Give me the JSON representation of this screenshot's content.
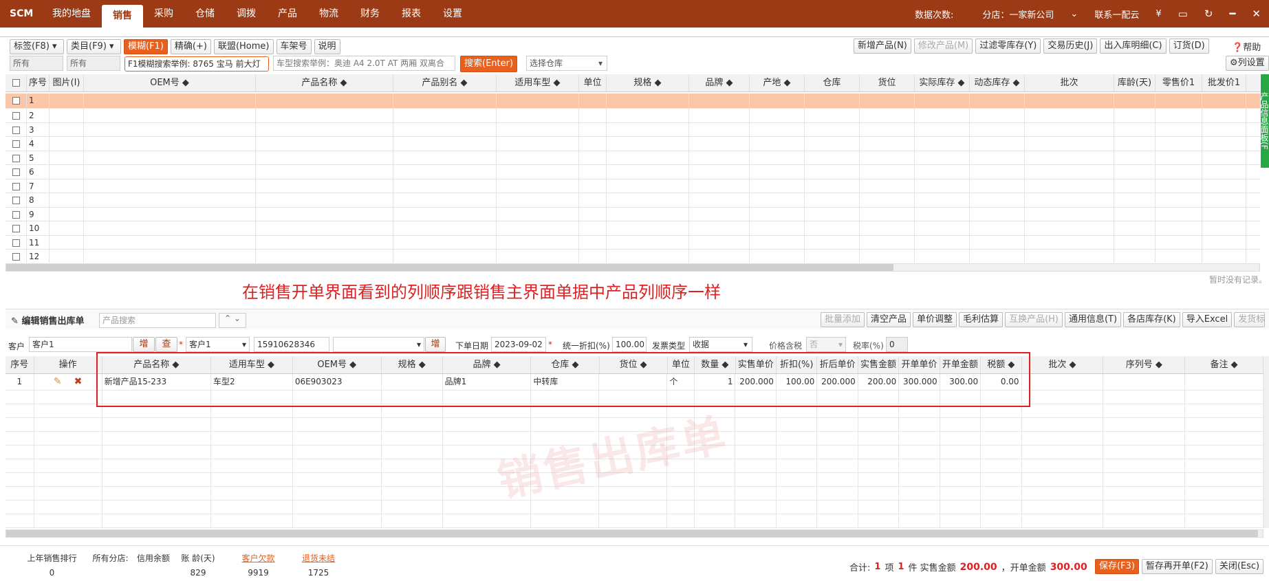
{
  "topbar": {
    "logo": "SCM",
    "nav": [
      "我的地盘",
      "销售",
      "采购",
      "仓储",
      "调拨",
      "产品",
      "物流",
      "财务",
      "报表",
      "设置"
    ],
    "active_index": 1,
    "data_count": "数据次数:",
    "branch": "分店：一家新公司",
    "account": "联系一配云",
    "currency": "¥",
    "accent": "#9b3a14"
  },
  "toolbar": {
    "tag_select": "标签(F8)",
    "category_select": "类目(F9)",
    "fuzzy_btn": "模糊(F1)",
    "exact_btn": "精确(+)",
    "alliance_btn": "联盟(Home)",
    "vin_btn": "车架号",
    "help_text_btn": "说明",
    "tag_value": "所有",
    "category_value": "所有",
    "search_hint": "F1模糊搜索举例: 8765 宝马 前大灯",
    "car_hint": "车型搜索举例：奥迪 A4 2.0T AT 两厢 双离合",
    "search_btn": "搜索(Enter)",
    "warehouse_select": "选择仓库",
    "new_product": "新增产品(N)",
    "edit_product": "修改产品(M)",
    "filter_zero": "过滤零库存(Y)",
    "trade_history": "交易历史(J)",
    "in_out_detail": "出入库明细(C)",
    "order": "订货(D)",
    "help": "帮助",
    "column_settings": "列设置"
  },
  "top_table": {
    "headers": [
      "序号",
      "图片(I)",
      "OEM号 ◆",
      "产品名称 ◆",
      "产品别名 ◆",
      "适用车型 ◆",
      "单位",
      "规格 ◆",
      "品牌 ◆",
      "产地 ◆",
      "仓库",
      "货位",
      "实际库存 ◆",
      "动态库存 ◆",
      "批次",
      "库龄(天)",
      "零售价1",
      "批发价1"
    ],
    "rows": [
      "1",
      "2",
      "3",
      "4",
      "5",
      "6",
      "7",
      "8",
      "9",
      "10",
      "11",
      "12"
    ],
    "empty_note": "暂时没有记录。",
    "side_tab": "产品信息面板(F"
  },
  "annotation": "在销售开单界面看到的列顺序跟销售主界面单据中产品列顺序一样",
  "edit": {
    "title": "编辑销售出库单",
    "product_search_placeholder": "产品搜索",
    "batch_add": "批量添加",
    "clear_products": "清空产品",
    "price_adjust": "单价调整",
    "profit_estimate": "毛利估算",
    "swap_product": "互换产品(H)",
    "common_info": "通用信息(T)",
    "store_stock": "各店库存(K)",
    "import_excel": "导入Excel",
    "ship_label": "发货标签",
    "customer_label": "客户",
    "customer_value": "客户1",
    "add_btn": "增",
    "check_btn": "查",
    "contact_value": "客户1",
    "phone_value": "15910628346",
    "add_btn2": "增",
    "order_date_label": "下单日期",
    "order_date": "2023-09-02",
    "discount_label": "统一折扣(%)",
    "discount_value": "100.00",
    "invoice_label": "发票类型",
    "invoice_value": "收据",
    "tax_incl_label": "价格含税",
    "tax_incl_value": "否",
    "tax_rate_label": "税率(%)",
    "tax_rate_value": "0"
  },
  "bottom_table": {
    "headers": [
      "序号",
      "操作",
      "产品名称 ◆",
      "适用车型 ◆",
      "OEM号 ◆",
      "规格 ◆",
      "品牌 ◆",
      "仓库 ◆",
      "货位 ◆",
      "单位",
      "数量 ◆",
      "实售单价",
      "折扣(%)",
      "折后单价",
      "实售金额",
      "开单单价",
      "开单金额",
      "税额 ◆",
      "批次 ◆",
      "序列号 ◆",
      "备注 ◆"
    ],
    "row": [
      "1",
      "",
      "新增产品15-233",
      "车型2",
      "06E903023",
      "",
      "品牌1",
      "中转库",
      "",
      "个",
      "1",
      "200.000",
      "100.00",
      "200.000",
      "200.00",
      "300.000",
      "300.00",
      "0.00",
      "",
      "",
      ""
    ]
  },
  "watermark": "销售出库单",
  "footer": {
    "stats_labels": [
      "上年销售排行",
      "所有分店:",
      "信用余额",
      "账 龄(天)",
      "客户欠款",
      "退货未结"
    ],
    "stats_values": [
      "0",
      "",
      "",
      "829",
      "9919",
      "1725"
    ],
    "total_label": "合计:",
    "items_count": "1",
    "items_unit": "项",
    "pieces_count": "1",
    "pieces_unit": "件 实售金额",
    "sale_amount": "200.00",
    "order_amount_label": "，开单金额",
    "order_amount": "300.00",
    "save_btn": "保存(F3)",
    "hold_btn": "暂存再开单(F2)",
    "close_btn": "关闭(Esc)"
  }
}
